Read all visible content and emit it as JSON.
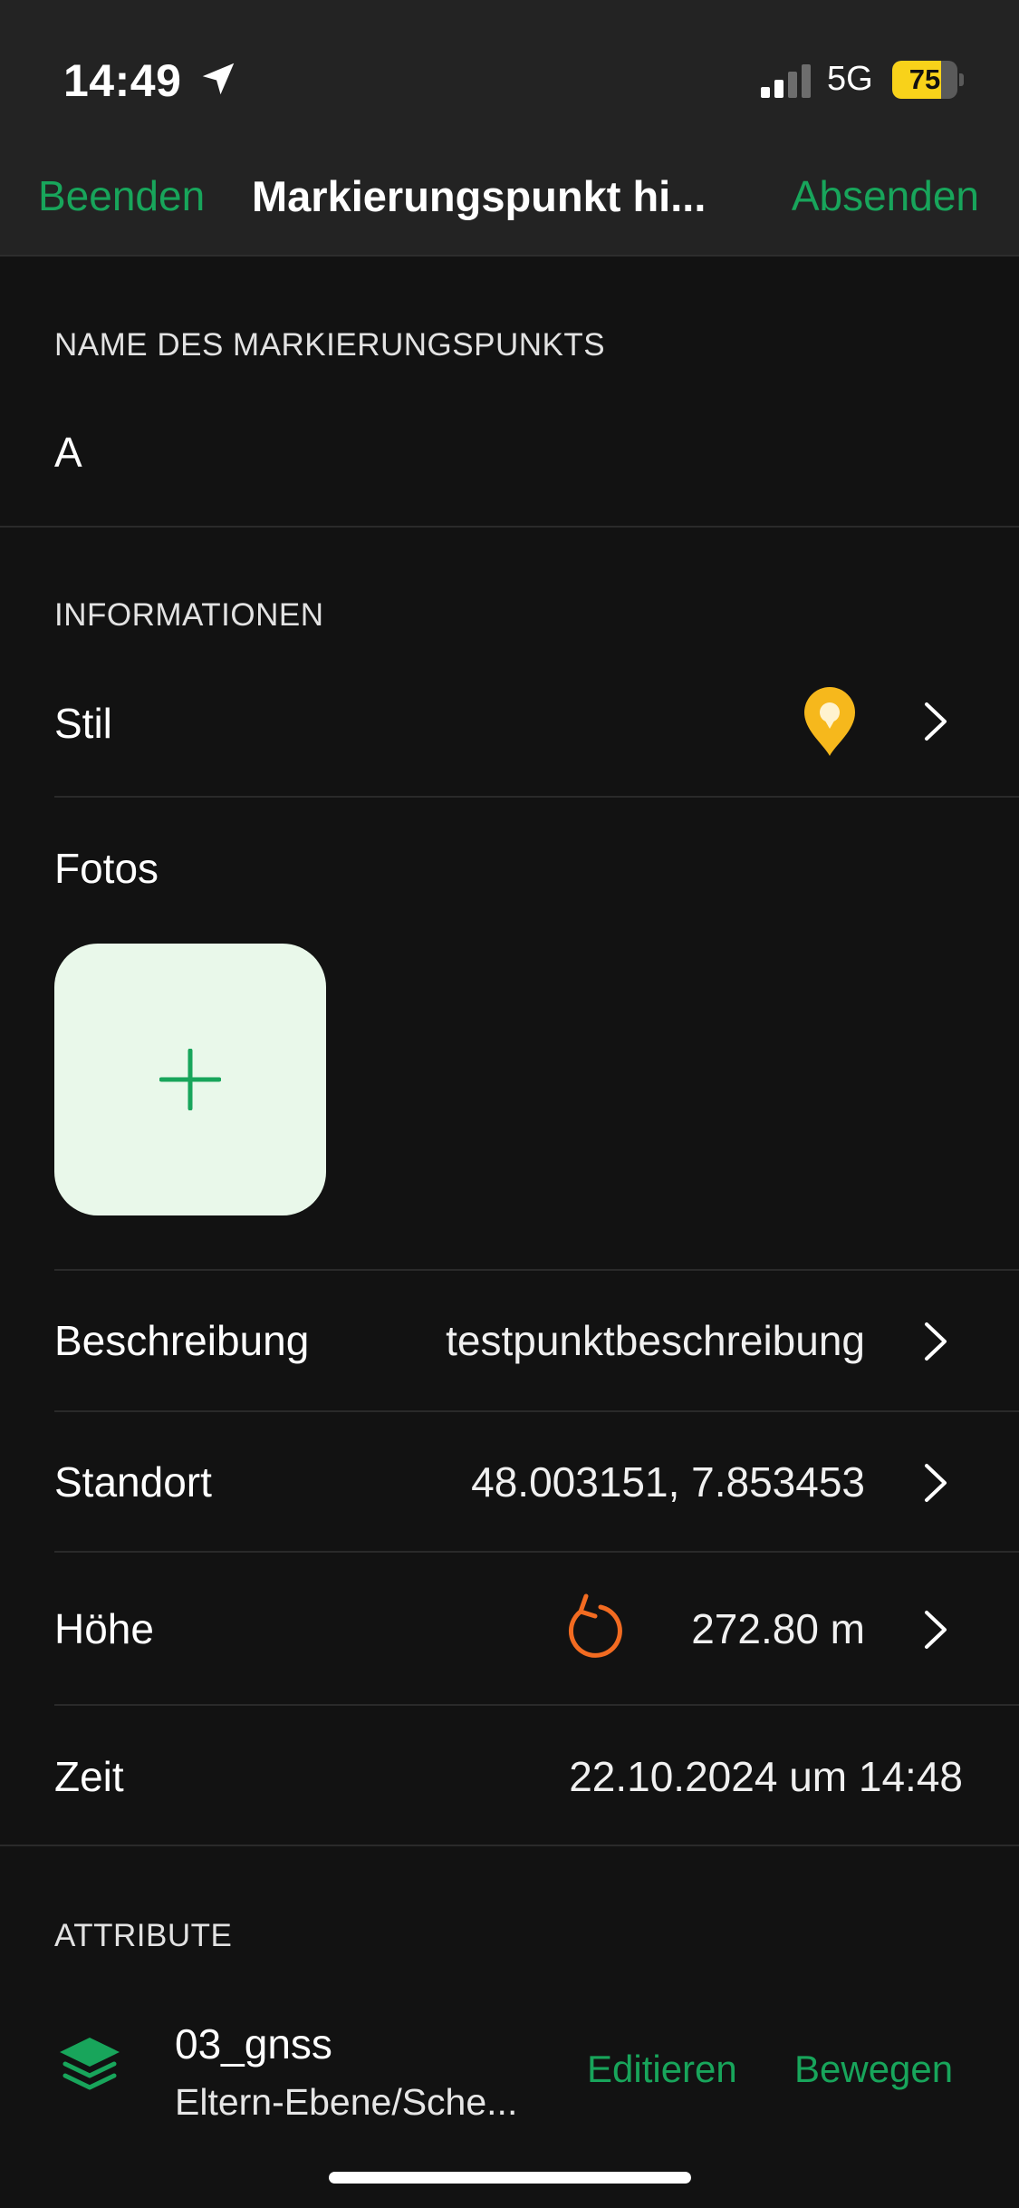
{
  "status_bar": {
    "time": "14:49",
    "network": "5G",
    "battery": "75",
    "battery_level": 0.75
  },
  "nav": {
    "left": "Beenden",
    "title": "Markierungspunkt hi...",
    "right": "Absenden"
  },
  "name_section": {
    "header": "NAME DES MARKIERUNGSPUNKTS",
    "value": "A"
  },
  "info_section": {
    "header": "INFORMATIONEN",
    "style_label": "Stil",
    "photos_label": "Fotos",
    "description_label": "Beschreibung",
    "description_value": "testpunktbeschreibung",
    "location_label": "Standort",
    "location_value": "48.003151, 7.853453",
    "altitude_label": "Höhe",
    "altitude_value": "272.80 m",
    "time_label": "Zeit",
    "time_value": "22.10.2024 um 14:48"
  },
  "attributes_section": {
    "header": "ATTRIBUTE",
    "item_title": "03_gnss",
    "item_subtitle": "Eltern-Ebene/Sche...",
    "edit_label": "Editieren",
    "move_label": "Bewegen"
  },
  "colors": {
    "accent": "#18a55b",
    "pin": "#f6b81c",
    "refresh": "#f26b21",
    "battery": "#f8d21a"
  },
  "icons": [
    "location-arrow-icon",
    "signal-icon",
    "battery-icon",
    "map-pin-icon",
    "plus-icon",
    "chevron-right-icon",
    "refresh-icon",
    "layers-icon"
  ]
}
